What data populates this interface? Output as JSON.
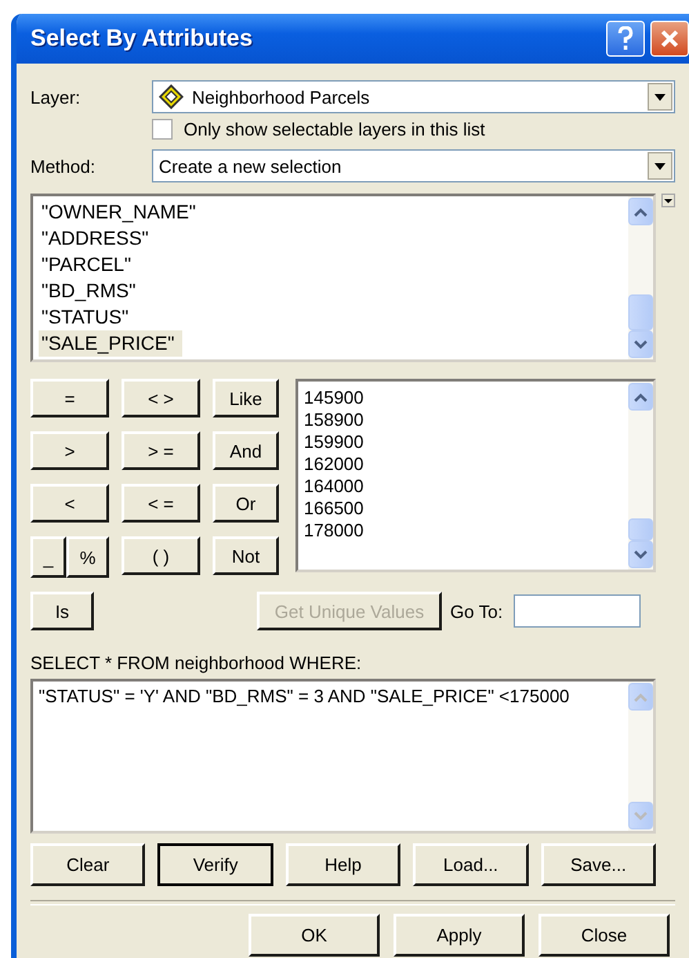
{
  "window": {
    "title": "Select By Attributes"
  },
  "layer": {
    "label": "Layer:",
    "value": "Neighborhood Parcels"
  },
  "selectable_only": {
    "label": "Only show selectable layers in this list",
    "checked": false
  },
  "method": {
    "label": "Method:",
    "value": "Create a new selection"
  },
  "fields": [
    {
      "label": "\"OWNER_NAME\"",
      "selected": false
    },
    {
      "label": "\"ADDRESS\"",
      "selected": false
    },
    {
      "label": "\"PARCEL\"",
      "selected": false
    },
    {
      "label": "\"BD_RMS\"",
      "selected": false
    },
    {
      "label": "\"STATUS\"",
      "selected": false
    },
    {
      "label": "\"SALE_PRICE\"",
      "selected": true
    }
  ],
  "operators": [
    {
      "kind": "single",
      "label": "="
    },
    {
      "kind": "single",
      "label": "< >"
    },
    {
      "kind": "single",
      "label": "Like"
    },
    {
      "kind": "single",
      "label": ">"
    },
    {
      "kind": "single",
      "label": "> ="
    },
    {
      "kind": "single",
      "label": "And"
    },
    {
      "kind": "single",
      "label": "<"
    },
    {
      "kind": "single",
      "label": "< ="
    },
    {
      "kind": "single",
      "label": "Or"
    },
    {
      "kind": "pair",
      "labels": [
        "_",
        "%"
      ]
    },
    {
      "kind": "single",
      "label": "( )"
    },
    {
      "kind": "single",
      "label": "Not"
    }
  ],
  "values": [
    "145900",
    "158900",
    "159900",
    "162000",
    "164000",
    "166500",
    "178000"
  ],
  "is_button": "Is",
  "unique_values_button": {
    "label": "Get Unique Values",
    "disabled": true
  },
  "go_to": {
    "label": "Go To:"
  },
  "sql_label": "SELECT * FROM neighborhood WHERE:",
  "expression": "\"STATUS\" = 'Y' AND \"BD_RMS\" = 3 AND \"SALE_PRICE\" <175000",
  "actions": [
    {
      "label": "Clear",
      "focused": false
    },
    {
      "label": "Verify",
      "focused": true
    },
    {
      "label": "Help",
      "focused": false
    },
    {
      "label": "Load...",
      "focused": false
    },
    {
      "label": "Save...",
      "focused": false
    }
  ],
  "footer_buttons": [
    "OK",
    "Apply",
    "Close"
  ]
}
